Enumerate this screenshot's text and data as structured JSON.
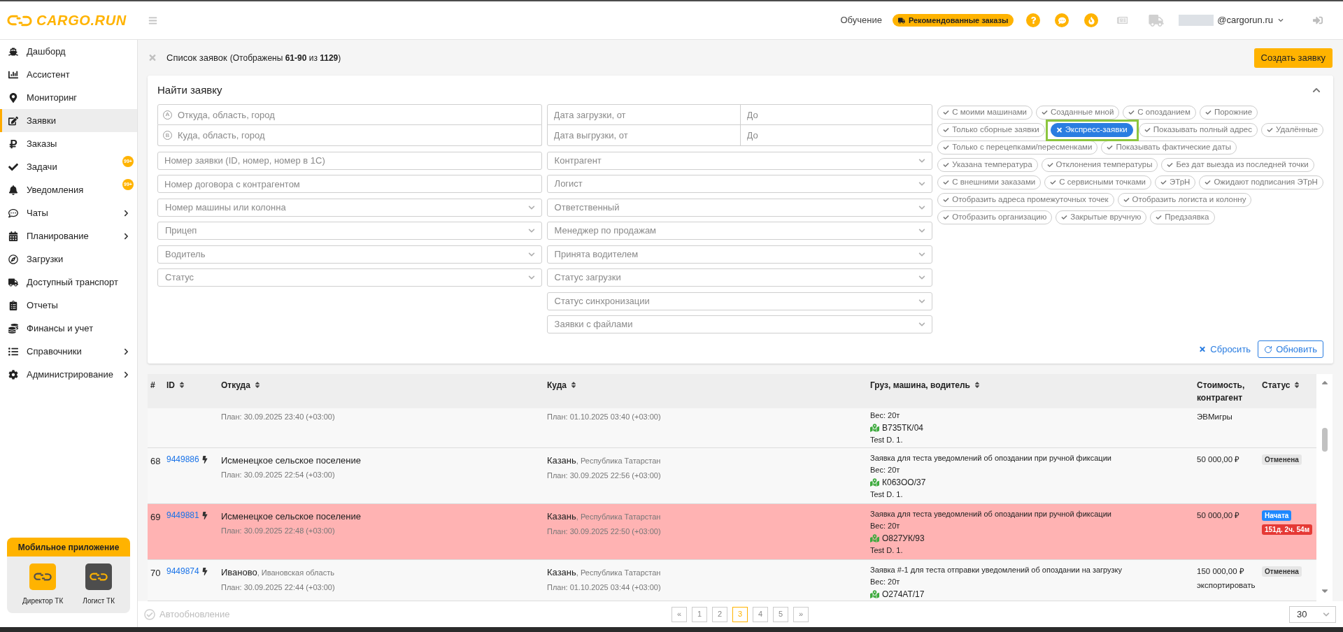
{
  "header": {
    "logo": "CARGO.RUN",
    "tutorial": "Обучение",
    "promo": "Рекомендованные заказы",
    "user": "@cargorun.ru"
  },
  "sidebar": {
    "items": [
      {
        "label": "Дашборд",
        "selected": false,
        "submenu": false
      },
      {
        "label": "Ассистент",
        "selected": false,
        "submenu": false
      },
      {
        "label": "Мониторинг",
        "selected": false,
        "submenu": false
      },
      {
        "label": "Заявки",
        "selected": true,
        "submenu": false
      },
      {
        "label": "Заказы",
        "selected": false,
        "submenu": false
      },
      {
        "label": "Задачи",
        "selected": false,
        "submenu": false,
        "badge": "99+"
      },
      {
        "label": "Уведомления",
        "selected": false,
        "submenu": false,
        "badge": "99+"
      },
      {
        "label": "Чаты",
        "selected": false,
        "submenu": true
      },
      {
        "label": "Планирование",
        "selected": false,
        "submenu": true
      },
      {
        "label": "Загрузки",
        "selected": false,
        "submenu": false
      },
      {
        "label": "Доступный транспорт",
        "selected": false,
        "submenu": false
      },
      {
        "label": "Отчеты",
        "selected": false,
        "submenu": false
      },
      {
        "label": "Финансы и учет",
        "selected": false,
        "submenu": false
      },
      {
        "label": "Справочники",
        "selected": false,
        "submenu": true
      },
      {
        "label": "Администрирование",
        "selected": false,
        "submenu": true
      }
    ],
    "mobile_app": {
      "title": "Мобильное приложение",
      "apps": [
        {
          "label": "Директор ТК",
          "color": "#ffb300"
        },
        {
          "label": "Логист ТК",
          "color": "#4d4d4d"
        }
      ]
    }
  },
  "page": {
    "title": "Список заявок",
    "subtitle": "(Отображены **61-90** из **1129**)",
    "create_button": "Создать заявку"
  },
  "filters": {
    "title": "Найти заявку",
    "expanded": true,
    "route": [
      {
        "marker": "A",
        "placeholder": "Откуда, область, город"
      },
      {
        "marker": "B",
        "placeholder": "Куда, область, город"
      }
    ],
    "dates": [
      [
        {
          "placeholder": "Дата загрузки, от"
        },
        {
          "placeholder": "До"
        }
      ],
      [
        {
          "placeholder": "Дата выгрузки, от"
        },
        {
          "placeholder": "До"
        }
      ]
    ],
    "left_fields": [
      {
        "placeholder": "Номер заявки (ID, номер, номер в 1С)",
        "kind": "input"
      },
      {
        "placeholder": "Номер договора с контрагентом",
        "kind": "input"
      },
      {
        "placeholder": "Номер машины или колонна",
        "kind": "select"
      },
      {
        "placeholder": "Прицеп",
        "kind": "select"
      },
      {
        "placeholder": "Водитель",
        "kind": "select"
      },
      {
        "placeholder": "Статус",
        "kind": "select"
      }
    ],
    "right_fields": [
      {
        "placeholder": "Контрагент",
        "kind": "select"
      },
      {
        "placeholder": "Логист",
        "kind": "select"
      },
      {
        "placeholder": "Ответственный",
        "kind": "select"
      },
      {
        "placeholder": "Менеджер по продажам",
        "kind": "select"
      },
      {
        "placeholder": "Принята водителем",
        "kind": "select"
      },
      {
        "placeholder": "Статус загрузки",
        "kind": "select"
      },
      {
        "placeholder": "Статус синхронизации",
        "kind": "select"
      },
      {
        "placeholder": "Заявки с файлами",
        "kind": "select"
      }
    ],
    "tag_rows": [
      [
        {
          "label": "С моими машинами",
          "selected": false,
          "highlighted": false
        },
        {
          "label": "Созданные мной",
          "selected": false,
          "highlighted": false
        },
        {
          "label": "С опозданием",
          "selected": false,
          "highlighted": false
        },
        {
          "label": "Порожние",
          "selected": false,
          "highlighted": false
        }
      ],
      [
        {
          "label": "Только сборные заявки",
          "selected": false,
          "highlighted": false
        },
        {
          "label": "Экспресс-заявки",
          "selected": true,
          "highlighted": true
        },
        {
          "label": "Показывать полный адрес",
          "selected": false,
          "highlighted": false
        },
        {
          "label": "Удалённые",
          "selected": false,
          "highlighted": false
        }
      ],
      [
        {
          "label": "Только с перецепками/пересменками",
          "selected": false,
          "highlighted": false
        },
        {
          "label": "Показывать фактические даты",
          "selected": false,
          "highlighted": false
        }
      ],
      [
        {
          "label": "Указана температура",
          "selected": false,
          "highlighted": false
        },
        {
          "label": "Отклонения температуры",
          "selected": false,
          "highlighted": false
        },
        {
          "label": "Без дат выезда из последней точки",
          "selected": false,
          "highlighted": false
        }
      ],
      [
        {
          "label": "С внешними заказами",
          "selected": false,
          "highlighted": false
        },
        {
          "label": "С сервисными точками",
          "selected": false,
          "highlighted": false
        },
        {
          "label": "ЭТрН",
          "selected": false,
          "highlighted": false
        },
        {
          "label": "Ожидают подписания ЭТрН",
          "selected": false,
          "highlighted": false
        }
      ],
      [
        {
          "label": "Отобразить адреса промежуточных точек",
          "selected": false,
          "highlighted": false
        },
        {
          "label": "Отобразить логиста и колонну",
          "selected": false,
          "highlighted": false
        }
      ],
      [
        {
          "label": "Отобразить организацию",
          "selected": false,
          "highlighted": false
        },
        {
          "label": "Закрытые вручную",
          "selected": false,
          "highlighted": false
        },
        {
          "label": "Предзаявка",
          "selected": false,
          "highlighted": false
        }
      ]
    ],
    "reset": "Сбросить",
    "refresh": "Обновить"
  },
  "table": {
    "columns": [
      {
        "label": "#",
        "sortable": false
      },
      {
        "label": "ID",
        "sortable": true
      },
      {
        "label": "Откуда",
        "sortable": true
      },
      {
        "label": "Куда",
        "sortable": true
      },
      {
        "label": "Груз, машина, водитель",
        "sortable": true
      },
      {
        "label": "Стоимость, контрагент",
        "sortable": false
      },
      {
        "label": "Статус",
        "sortable": true
      }
    ],
    "rows": [
      {
        "from": {
          "plan": "План: 30.09.2025 23:40 (+03:00)"
        },
        "to": {
          "plan": "План: 01.10.2025 03:40 (+03:00)"
        },
        "cargo": {
          "weight": "Вес: 20т",
          "plate": "В735ТК/04",
          "driver": "Test D. 1."
        },
        "contractor": "ЭВМигры",
        "highlighted": false
      },
      {
        "number": "68",
        "id": "9449886",
        "express": true,
        "from": {
          "city": "Исменецкое сельское поселение",
          "plan": "План: 30.09.2025 22:54 (+03:00)"
        },
        "to": {
          "city": "Казань",
          "region": ", Республика Татарстан",
          "plan": "План: 30.09.2025 22:56 (+03:00)"
        },
        "cargo": {
          "description": "Заявка для теста уведомлений об опоздании при ручной фиксации",
          "weight": "Вес: 20т",
          "plate": "К063ОО/37",
          "driver": "Test D. 1."
        },
        "cost": "50 000,00 ₽",
        "statuses": [
          {
            "label": "Отменена",
            "kind": "cancelled"
          }
        ],
        "highlighted": false
      },
      {
        "number": "69",
        "id": "9449881",
        "express": true,
        "from": {
          "city": "Исменецкое сельское поселение",
          "plan": "План: 30.09.2025 22:48 (+03:00)"
        },
        "to": {
          "city": "Казань",
          "region": ", Республика Татарстан",
          "plan": "План: 30.09.2025 22:50 (+03:00)"
        },
        "cargo": {
          "description": "Заявка для теста уведомлений об опоздании при ручной фиксации",
          "weight": "Вес: 20т",
          "plate": "О827УК/93",
          "driver": "Test D. 1."
        },
        "cost": "50 000,00 ₽",
        "statuses": [
          {
            "label": "Начата",
            "kind": "started"
          },
          {
            "label": "151д. 2ч. 54м",
            "kind": "overdue"
          }
        ],
        "highlighted": true
      },
      {
        "number": "70",
        "id": "9449874",
        "express": true,
        "from": {
          "city": "Иваново",
          "region": ", Ивановская область",
          "plan": "План: 30.09.2025 22:44 (+03:00)"
        },
        "to": {
          "city": "Казань",
          "region": ", Республика Татарстан",
          "plan": "План: 01.10.2025 03:44 (+03:00)"
        },
        "cargo": {
          "description": "Заявка #-1 для теста отправки уведомлений об опоздании на загрузку",
          "weight": "Вес: 20т",
          "plate": "О274АТ/17"
        },
        "cost": "150 000,00 ₽",
        "contractor": "экспортировать",
        "statuses": [
          {
            "label": "Отменена",
            "kind": "cancelled"
          }
        ],
        "highlighted": false
      }
    ]
  },
  "footer": {
    "autoupdate": {
      "label": "Автообновление",
      "checked": false
    },
    "pages": [
      {
        "label": "«",
        "selected": false
      },
      {
        "label": "1",
        "selected": false
      },
      {
        "label": "2",
        "selected": false
      },
      {
        "label": "3",
        "selected": true
      },
      {
        "label": "4",
        "selected": false
      },
      {
        "label": "5",
        "selected": false
      },
      {
        "label": "»",
        "selected": false
      }
    ],
    "page_size": "30"
  }
}
